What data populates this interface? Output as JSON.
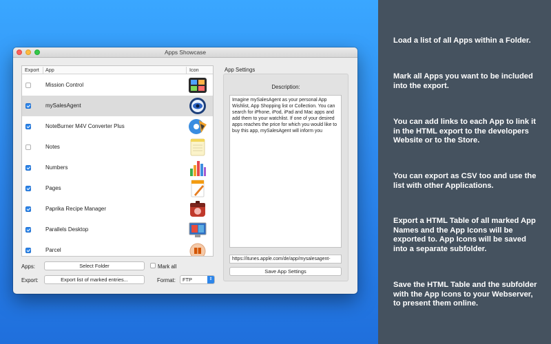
{
  "window": {
    "title": "Apps Showcase"
  },
  "table": {
    "headers": {
      "export": "Export",
      "app": "App",
      "icon": "Icon"
    },
    "rows": [
      {
        "name": "Mission Control",
        "checked": false,
        "icon": "mission-control-icon"
      },
      {
        "name": "mySalesAgent",
        "checked": true,
        "icon": "mysalesagent-icon",
        "selected": true
      },
      {
        "name": "NoteBurner M4V Converter Plus",
        "checked": true,
        "icon": "noteburner-icon"
      },
      {
        "name": "Notes",
        "checked": false,
        "icon": "notes-icon"
      },
      {
        "name": "Numbers",
        "checked": true,
        "icon": "numbers-icon"
      },
      {
        "name": "Pages",
        "checked": true,
        "icon": "pages-icon"
      },
      {
        "name": "Paprika Recipe Manager",
        "checked": true,
        "icon": "paprika-icon"
      },
      {
        "name": "Parallels Desktop",
        "checked": true,
        "icon": "parallels-icon"
      },
      {
        "name": "Parcel",
        "checked": true,
        "icon": "parcel-icon"
      }
    ]
  },
  "controls": {
    "apps_label": "Apps:",
    "select_folder": "Select Folder",
    "mark_all": "Mark all",
    "export_label": "Export:",
    "export_button": "Export list of marked entries...",
    "format_label": "Format:",
    "format_value": "FTP"
  },
  "settings": {
    "group_title": "App Settings",
    "description_label": "Description:",
    "description_text": "Imagine mySalesAgent as your personal App Wishlist, App Shopping list or Collection. You can search for iPhone, iPod, iPad and Mac apps and add them to your watchlist. If one of your desired apps reaches the price for which you would like to buy this app, mySalesAgent will inform you",
    "url_value": "https://itunes.apple.com/de/app/mysalesagent-",
    "save_button": "Save App Settings"
  },
  "features": [
    "Load a list of all Apps within a Folder.",
    "Mark all Apps you want to be included into the export.",
    "You can add links to each App to link it in the HTML export to the developers Website or to the Store.",
    "You can export as CSV too and use the list with other Applications.",
    "Export a HTML Table of all marked App Names and the App Icons will be exported to. App Icons will be saved into a separate subfolder.",
    "Save the HTML Table and the subfolder with the App Icons to your Webserver, to present them online."
  ],
  "colors": {
    "accent": "#2d86ea",
    "background_left": "#2e8af0",
    "background_right": "#45525f"
  }
}
